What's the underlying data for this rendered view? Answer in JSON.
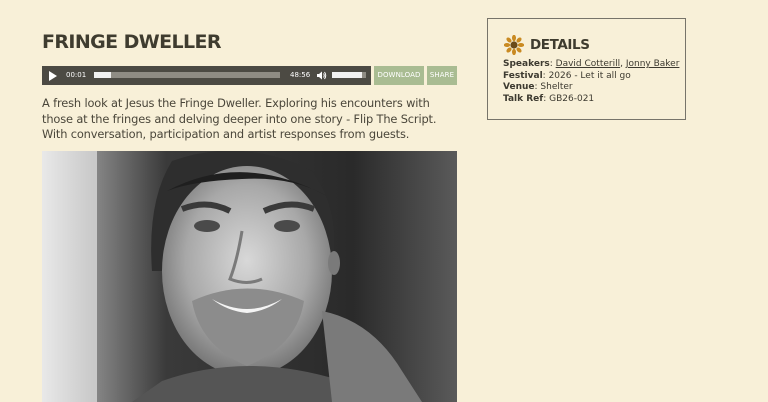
{
  "page": {
    "title": "FRINGE DWELLER",
    "description": "A fresh look at Jesus the Fringe Dweller. Exploring his encounters with those at the fringes and delving deeper into one story - Flip The Script. With conversation, participation and artist responses from guests."
  },
  "player": {
    "current_time": "00:01",
    "total_time": "48:56",
    "progress_fraction": 0.09,
    "volume_fraction": 0.88,
    "download_label": "DOWNLOAD",
    "share_label": "SHARE"
  },
  "details": {
    "heading": "DETAILS",
    "icon": "sunflower-icon",
    "speakers_label": "Speakers",
    "speaker_1": "David Cotterill",
    "speaker_2": "Jonny Baker",
    "festival_label": "Festival",
    "festival_value": "2026 - Let it all go",
    "venue_label": "Venue",
    "venue_value": "Shelter",
    "talk_ref_label": "Talk Ref",
    "talk_ref_value": "GB26-021"
  },
  "colors": {
    "background": "#f8f0d8",
    "player_bar": "#4c4a43",
    "button_green": "#a9bc92",
    "heading_text": "#3f3c2f"
  }
}
